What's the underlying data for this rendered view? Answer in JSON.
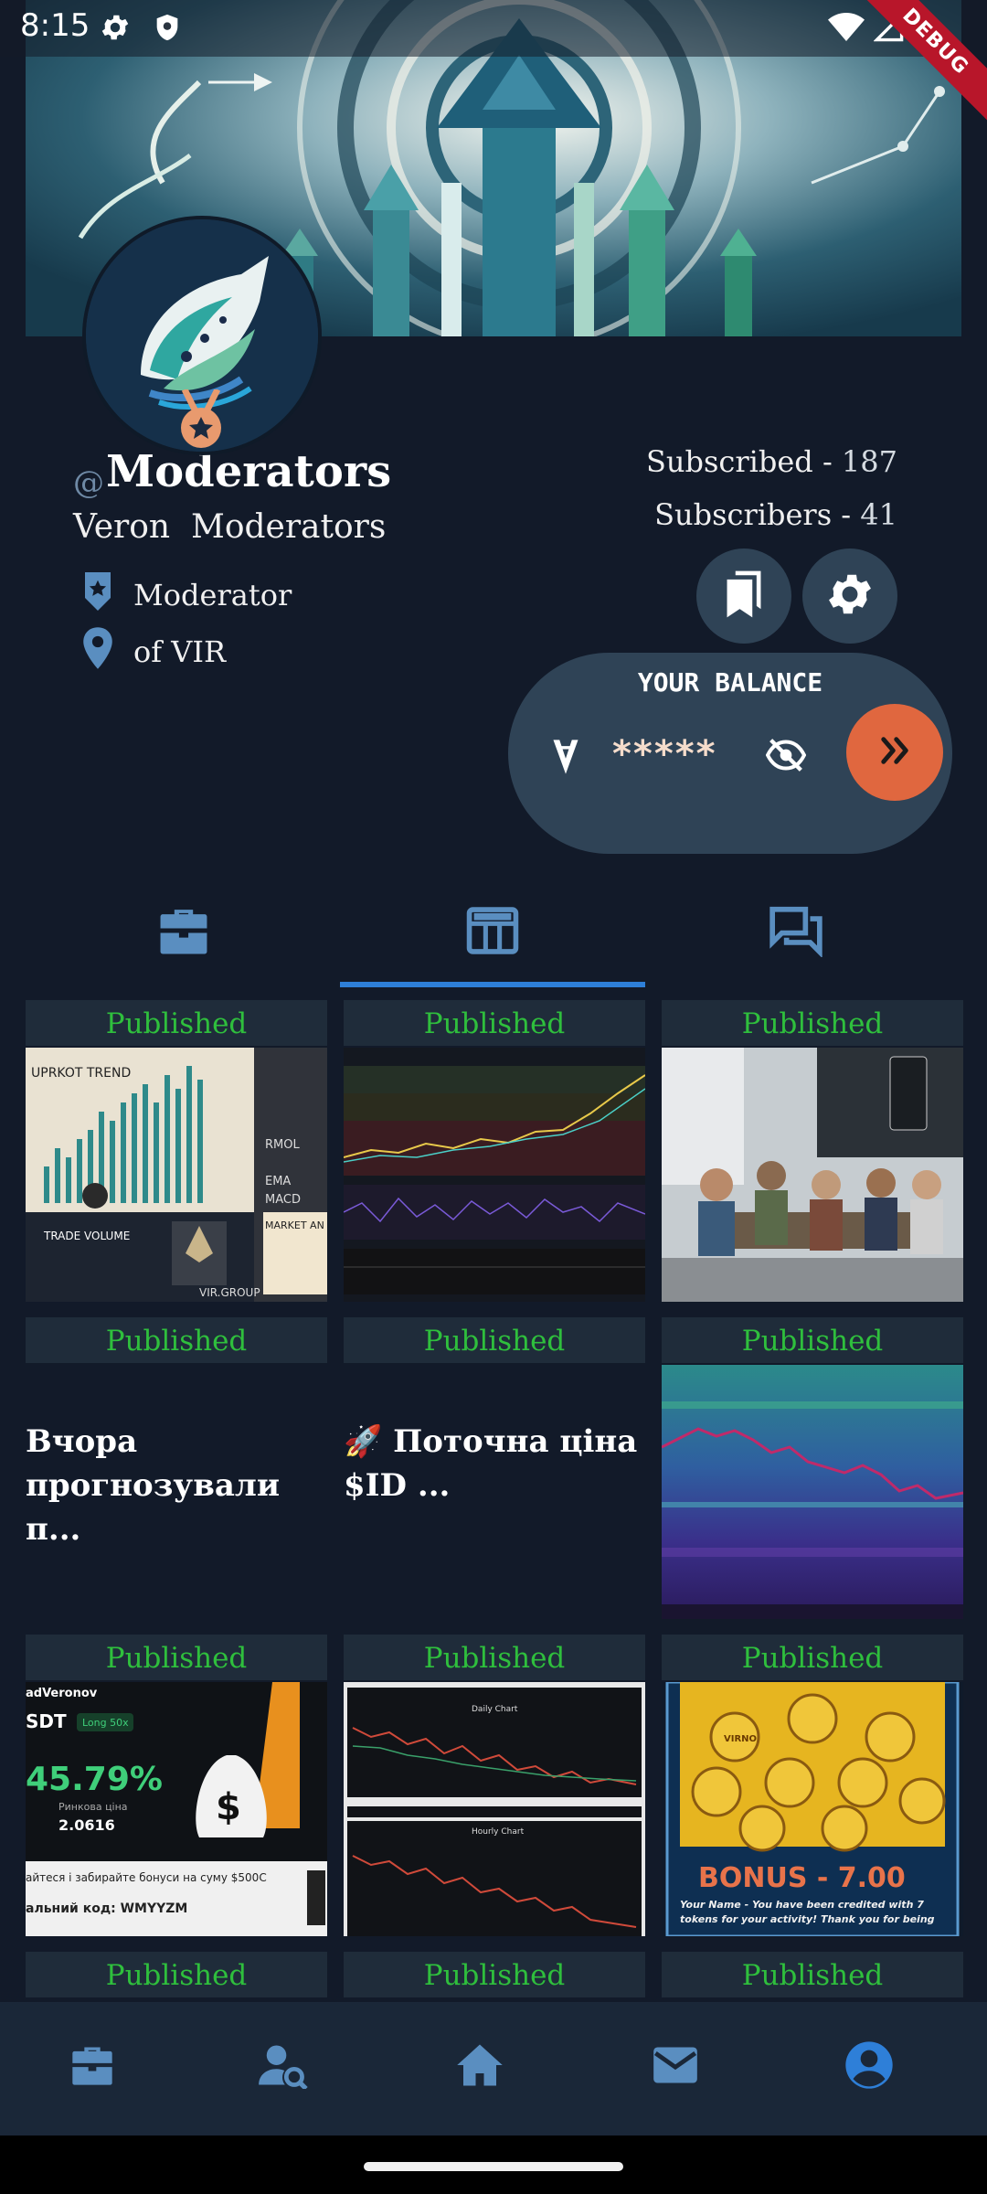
{
  "status_bar": {
    "time": "8:15",
    "debug_label": "DEBUG"
  },
  "profile": {
    "handle_prefix": "@",
    "handle": "Moderators",
    "full_name": "Veron  Moderators",
    "role": "Moderator",
    "location": "of VIR",
    "subscribed_label": "Subscribed -",
    "subscribed_count": "187",
    "subscribers_label": "Subscribers -",
    "subscribers_count": "41"
  },
  "balance": {
    "title": "YOUR BALANCE",
    "masked_value": "*****"
  },
  "tabs": [
    {
      "icon": "briefcase-icon"
    },
    {
      "icon": "newspaper-icon"
    },
    {
      "icon": "forum-icon"
    }
  ],
  "posts": [
    {
      "status": "Published",
      "thumb": "crypto-infographic"
    },
    {
      "status": "Published",
      "thumb": "trading-chart"
    },
    {
      "status": "Published",
      "thumb": "team-meeting"
    },
    {
      "status": "Published",
      "text": "Вчора прогнозували п..."
    },
    {
      "status": "Published",
      "text": "🚀 Поточна ціна $ID ..."
    },
    {
      "status": "Published",
      "thumb": "heatmap-chart"
    },
    {
      "status": "Published",
      "thumb": "profit-card"
    },
    {
      "status": "Published",
      "thumb": "daily-hourly-chart"
    },
    {
      "status": "Published",
      "thumb": "bonus-coins"
    },
    {
      "status": "Published"
    },
    {
      "status": "Published"
    },
    {
      "status": "Published"
    }
  ],
  "thumb_text": {
    "crypto": [
      "UPRKOT TREND",
      "TRADE VOLUME",
      "RMOL",
      "EMA",
      "MACD",
      "VIR.GROUP",
      "MARKET AN"
    ],
    "profit": {
      "user": "adVeronov",
      "pair": "SDT",
      "leverage": "Long 50x",
      "pct": "45.79%",
      "price": "2.0616",
      "price_label": "Ринкова ціна",
      "footer": "айтеся і забирайте бонуси на суму $500С",
      "code": "альний  код: WMYYZM"
    },
    "daily_chart": {
      "top": "Daily Chart",
      "bottom": "Hourly Chart"
    },
    "bonus": {
      "coin": "VIRNO",
      "title": "BONUS - 7.00",
      "message": "Your Name - You have been credited with 7 tokens for your activity! Thank you for being"
    }
  },
  "bottom_nav": [
    {
      "icon": "briefcase-icon",
      "active": false
    },
    {
      "icon": "person-search-icon",
      "active": false
    },
    {
      "icon": "home-icon",
      "active": false
    },
    {
      "icon": "mail-icon",
      "active": false
    },
    {
      "icon": "account-circle-icon",
      "active": true
    }
  ],
  "colors": {
    "background": "#121a29",
    "accent_orange": "#e0673f",
    "published_green": "#2fbf3d",
    "tab_blue": "#2e7fd8",
    "icon_blue": "#5a8ec0"
  }
}
